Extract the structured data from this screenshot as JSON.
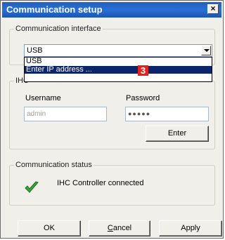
{
  "window": {
    "title": "Communication setup",
    "close_glyph": "×"
  },
  "interface_group": {
    "legend": "Communication interface",
    "selected_value": "USB",
    "dropdown_options": [
      "USB",
      "Enter IP address ...",
      ""
    ],
    "highlighted_index": 1,
    "badge": "3"
  },
  "login_group": {
    "legend": "IHC",
    "username_label": "Username",
    "username_value": "admin",
    "password_label": "Password",
    "password_value": "●●●●●",
    "enter_button": "Enter"
  },
  "status_group": {
    "legend": "Communication status",
    "status_text": "IHC Controller connected",
    "status_icon": "checkmark-icon",
    "status_color": "#2f9e2f"
  },
  "footer": {
    "ok": "OK",
    "cancel": "Cancel",
    "apply": "Apply"
  }
}
